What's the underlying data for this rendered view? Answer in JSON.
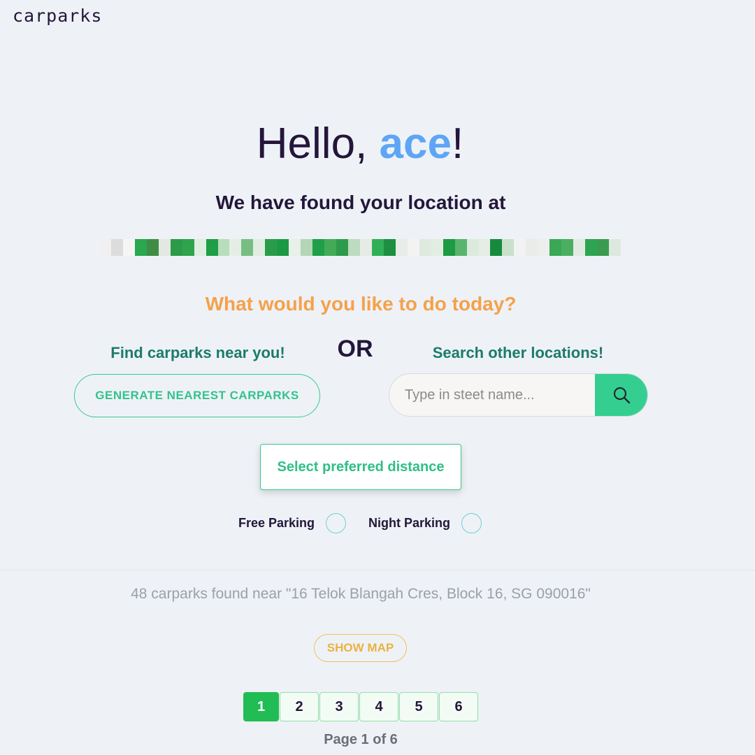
{
  "header": {
    "brand": "carparks"
  },
  "greeting": {
    "prefix": "Hello, ",
    "name": "ace",
    "suffix": "!"
  },
  "location": {
    "heading": "We have found your location at",
    "pixel_colors": [
      "#f0f0f0",
      "#dcdcdc",
      "#f5f5f5",
      "#29a84f",
      "#3f8c45",
      "#e3e8e3",
      "#2d9a4a",
      "#2fa34d",
      "#dfeee0",
      "#1f9d47",
      "#b8ddbd",
      "#e5eee5",
      "#78be83",
      "#e2ece2",
      "#2a9c49",
      "#1c9944",
      "#e9efe9",
      "#b3d6b6",
      "#1f9f47",
      "#43ab58",
      "#2e9b4b",
      "#bcdcbf",
      "#e6ebe6",
      "#2fb056",
      "#1d8f41",
      "#e8ece8",
      "#f3f3f3",
      "#dfe9df",
      "#e2eee2",
      "#1c9a44",
      "#5ab46d",
      "#dceade",
      "#e5ede5",
      "#178b3d",
      "#c9e1cb",
      "#f2f2f2",
      "#e9ece9",
      "#eeeeee",
      "#3aa856",
      "#4bae61",
      "#e2ebe2",
      "#2da452",
      "#3a9b4f",
      "#dde8de"
    ]
  },
  "prompt": {
    "question": "What would you like to do today?",
    "left_label": "Find carparks near you!",
    "or_label": "OR",
    "right_label": "Search other locations!"
  },
  "actions": {
    "generate_label": "GENERATE NEAREST CARPARKS",
    "search_placeholder": "Type in steet name...",
    "search_value": "",
    "distance_label": "Select preferred distance"
  },
  "filters": {
    "free_label": "Free Parking",
    "free_checked": false,
    "night_label": "Night Parking",
    "night_checked": false
  },
  "results": {
    "summary": "48 carparks found near \"16 Telok Blangah Cres, Block 16, SG 090016\"",
    "map_label": "SHOW MAP"
  },
  "pagination": {
    "pages": [
      "1",
      "2",
      "3",
      "4",
      "5",
      "6"
    ],
    "current": "1",
    "info": "Page 1 of 6"
  },
  "colors": {
    "background": "#eef2f7",
    "accent_green": "#34cf90",
    "accent_blue": "#5ea6f5",
    "accent_orange": "#f5a14a",
    "accent_yellow": "#f2bf55"
  },
  "icons": {
    "search": "search-icon"
  }
}
